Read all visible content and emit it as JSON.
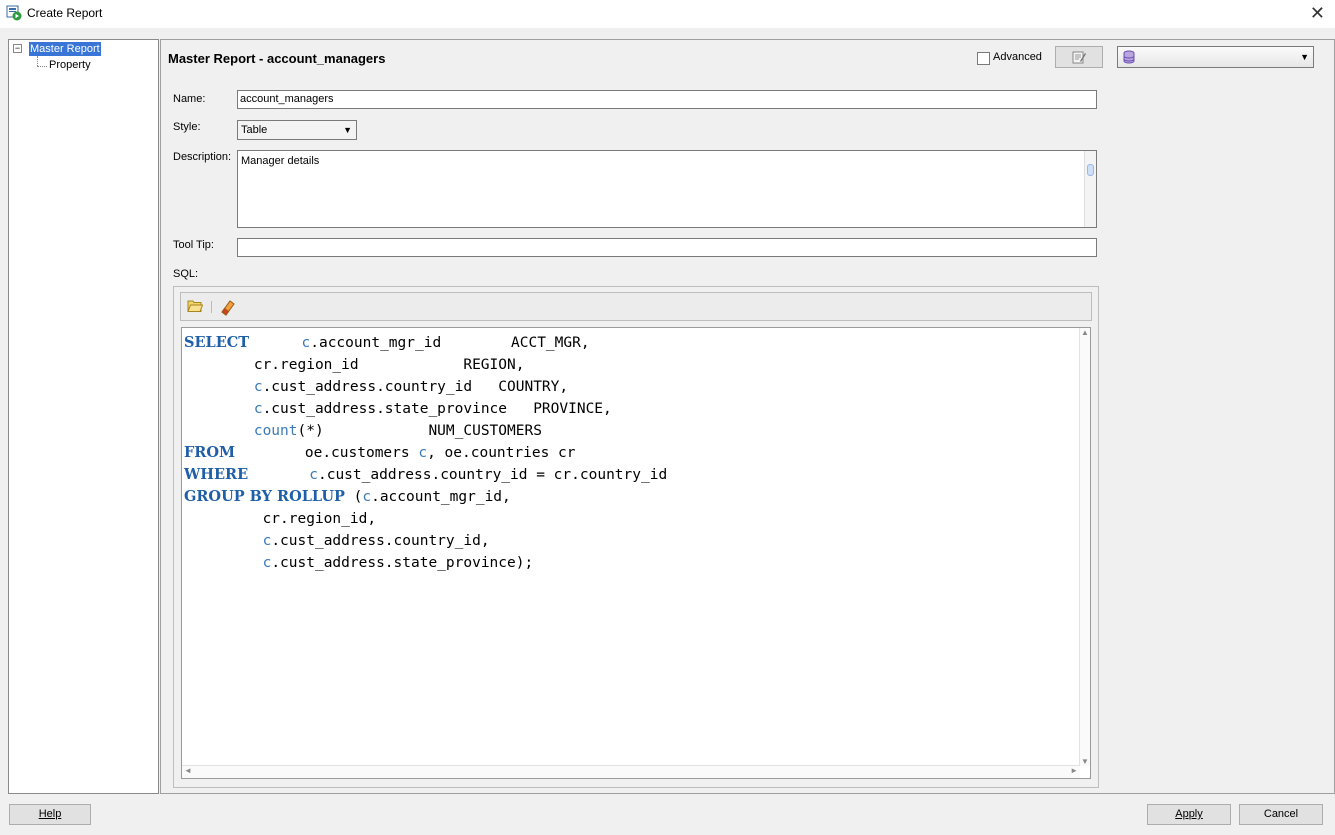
{
  "window": {
    "title": "Create Report",
    "close_symbol": "✕"
  },
  "tree": {
    "master": "Master Report",
    "property": "Property",
    "toggle": "−"
  },
  "header": {
    "title": "Master Report - account_managers",
    "advanced_label": "Advanced"
  },
  "form": {
    "name_label": "Name:",
    "name_value": "account_managers",
    "style_label": "Style:",
    "style_value": "Table",
    "description_label": "Description:",
    "description_value": "Manager details",
    "tooltip_label": "Tool Tip:",
    "tooltip_value": "",
    "sql_label": "SQL:"
  },
  "icons": [
    "app-report-icon",
    "edit-icon",
    "database-icon",
    "open-folder-icon",
    "eraser-icon"
  ],
  "colors": {
    "keyword": "#1f5fa8",
    "alias": "#3a7ab8",
    "selection": "#3875d7"
  },
  "footer": {
    "help": "Help",
    "apply": "Apply",
    "cancel": "Cancel"
  }
}
